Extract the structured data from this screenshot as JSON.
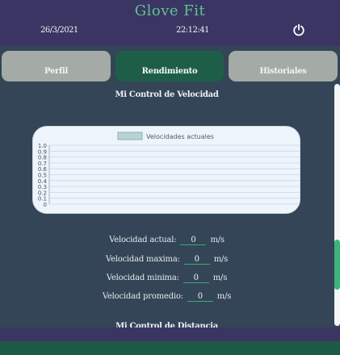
{
  "app": {
    "title": "Glove Fit",
    "date": "26/3/2021",
    "time": "22:12:41",
    "power_icon": "power-icon"
  },
  "tabs": [
    {
      "label": "Perfil",
      "active": false
    },
    {
      "label": "Rendimiento",
      "active": true
    },
    {
      "label": "Historiales",
      "active": false
    }
  ],
  "section": {
    "title": "Mi Control de Velocidad"
  },
  "chart_data": {
    "type": "line",
    "legend": [
      "Velocidades actuales"
    ],
    "series": [
      {
        "name": "Velocidades actuales",
        "values": []
      }
    ],
    "y_ticks": [
      "1.0",
      "0.9",
      "0.8",
      "0.7",
      "0.6",
      "0.5",
      "0.4",
      "0.3",
      "0.2",
      "0.1",
      "0"
    ],
    "ylim": [
      0,
      1
    ],
    "grid": true,
    "legend_position": "top",
    "colors": {
      "series_fill": "#b9d2d4",
      "series_stroke": "#8fb0b2",
      "grid": "#c9d6e4",
      "background": "#eef4fb"
    }
  },
  "stats": [
    {
      "label": "Velocidad actual:",
      "value": "0",
      "unit": "m/s"
    },
    {
      "label": "Velocidad maxima:",
      "value": "0",
      "unit": "m/s"
    },
    {
      "label": "Velocidad minima:",
      "value": "0",
      "unit": "m/s"
    },
    {
      "label": "Velocidad promedio:",
      "value": "0",
      "unit": "m/s"
    }
  ],
  "next_section": {
    "title": "Mi Control de Distancia"
  },
  "colors": {
    "header": "#3b3563",
    "accent": "#5fc48e",
    "active_tab": "#1e5e48",
    "inactive_tab": "#a4aaa6",
    "background": "#334556"
  }
}
